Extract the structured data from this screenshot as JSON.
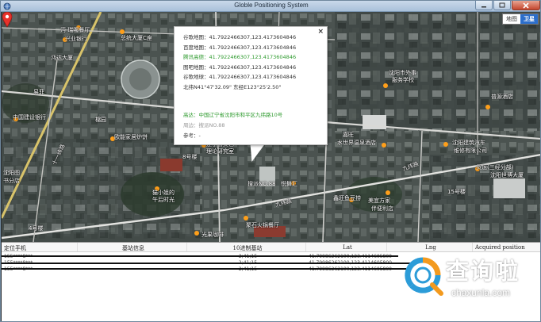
{
  "window": {
    "title": "Globle Positioning System"
  },
  "map_type": {
    "map_label": "地图",
    "satellite_label": "卫星",
    "selected": "卫星"
  },
  "popup": {
    "lines": [
      {
        "label": "谷歌地图：",
        "value": "41.7922466307,123.4173604846",
        "color": "normal"
      },
      {
        "label": "百度地图：",
        "value": "41.7922466307,123.4173604846",
        "color": "normal"
      },
      {
        "label": "腾讯高德：",
        "value": "41.7922466307,123.4173604846",
        "color": "green"
      },
      {
        "label": "图吧地图：",
        "value": "41.7922466307,123.4173604846",
        "color": "normal"
      },
      {
        "label": "谷歌地球：",
        "value": "41.7922466307,123.4173604846",
        "color": "normal"
      }
    ],
    "dms": "北纬N41°47'32.09\" 东经E123°25'2.50\"",
    "address_label": "高达：",
    "address_value": "中国辽宁省沈阳市和平区九纬路10号",
    "nearby_label": "周边：",
    "nearby_value": "搜派NO.88",
    "ref_label": "参考：",
    "ref_value": "-",
    "close": "×"
  },
  "map_labels": [
    {
      "text": "沈阳市外事",
      "name": "label-foreign-affairs"
    },
    {
      "text": "服务学校",
      "name": "label-service-school"
    },
    {
      "text": "沈阳建筑汽车",
      "name": "label-auto-company"
    },
    {
      "text": "维修有限公司",
      "name": "label-repair-company"
    },
    {
      "text": "普源酒店",
      "name": "label-puyuan-hotel"
    },
    {
      "text": "辽宁省文艺",
      "name": "label-liaoning-arts"
    },
    {
      "text": "理论研究室",
      "name": "label-theory-research"
    },
    {
      "text": "欧能家居炉饼",
      "name": "label-ouneng"
    },
    {
      "text": "中国建设银行",
      "name": "label-ccb"
    },
    {
      "text": "沔达大厦",
      "name": "label-miandai"
    },
    {
      "text": "总统大厦C座",
      "name": "label-president-c"
    },
    {
      "text": "沔·瑞喔餐厅",
      "name": "label-restaurant"
    },
    {
      "text": "兴业银行",
      "name": "label-cib"
    },
    {
      "text": "易菲",
      "name": "label-yifei"
    },
    {
      "text": "檔园",
      "name": "label-dangyuan"
    },
    {
      "text": "8号楼",
      "name": "label-bldg8"
    },
    {
      "text": "搜派NO.88",
      "name": "label-soupai"
    },
    {
      "text": "悦舞汇",
      "name": "label-yuewuhui"
    },
    {
      "text": "嘉旺",
      "name": "label-jiawang"
    },
    {
      "text": "水世界温泉酒店",
      "name": "label-water-world"
    },
    {
      "text": "九纬路",
      "name": "label-jiuwei-road"
    },
    {
      "text": "九纬路",
      "name": "label-jiuwei-road-2"
    },
    {
      "text": "15号楼",
      "name": "label-bldg15"
    },
    {
      "text": "货运(三经分部)",
      "name": "label-freight"
    },
    {
      "text": "沈阳世博大厦",
      "name": "label-expo-tower"
    },
    {
      "text": "鑫旺鱼豆捞",
      "name": "label-xinwang"
    },
    {
      "text": "美宜方家",
      "name": "label-meiyi"
    },
    {
      "text": "伴便利店",
      "name": "label-store"
    },
    {
      "text": "猫小姐的",
      "name": "label-cat-miss"
    },
    {
      "text": "午后时光",
      "name": "label-afternoon"
    },
    {
      "text": "聚石火锅餐厅",
      "name": "label-hotpot"
    },
    {
      "text": "光果咖啡",
      "name": "label-coffee"
    },
    {
      "text": "4号楼",
      "name": "label-bldg4"
    },
    {
      "text": "沈阳图",
      "name": "label-shenyang-library"
    },
    {
      "text": "书分店",
      "name": "label-bookstore"
    },
    {
      "text": "十一纬路",
      "name": "label-11wei-road"
    }
  ],
  "table": {
    "headers": [
      "定位手机",
      "基站信息",
      "10进制基站",
      "Lat",
      "Lng",
      "Acquired position"
    ],
    "rows": [
      {
        "phone": "155****8***",
        "base": "",
        "dec": "2;41;15",
        "lat": "41.79986262100,123.4114605800",
        "lng": "",
        "acq": ""
      },
      {
        "phone": "155****8***",
        "base": "",
        "dec": "2;41;15",
        "lat": "41.79986262100,123.4114605800",
        "lng": "",
        "acq": ""
      },
      {
        "phone": "155****8***",
        "base": "",
        "dec": "2;41;15",
        "lat": "41.79986262100,123.4114605800",
        "lng": "",
        "acq": ""
      }
    ]
  },
  "watermark": {
    "text": "查询啦",
    "sub": "chaxunla.com"
  },
  "colors": {
    "accent": "#2c6ecb",
    "green": "#2f9b2f",
    "logo_orange": "#f39a1e",
    "logo_blue": "#2c9cd8"
  }
}
